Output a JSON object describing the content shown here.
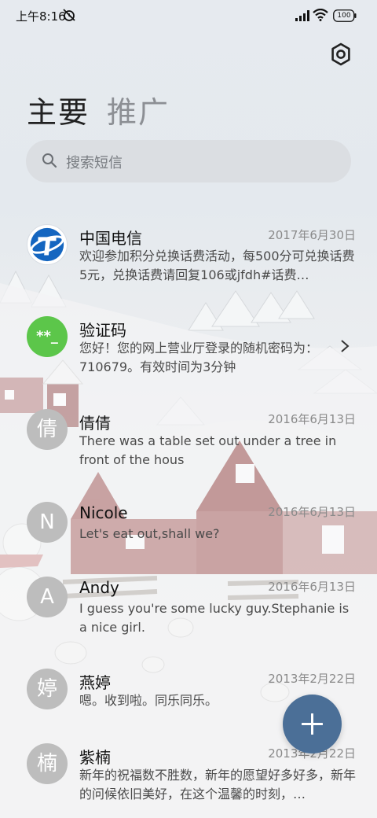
{
  "status_bar": {
    "time": "上午8:16",
    "battery": "100"
  },
  "tabs": [
    {
      "label": "主要"
    },
    {
      "label": "推广"
    }
  ],
  "search": {
    "placeholder": "搜索短信"
  },
  "messages": [
    {
      "sender": "中国电信",
      "date": "2017年6月30日",
      "preview": "欢迎参加积分兑换话费活动，每500分可兑换话费5元，兑换话费请回复106或jfdh#话费…",
      "avatar": "china-telecom-logo"
    },
    {
      "sender": "验证码",
      "date": "",
      "preview": "您好！您的网上营业厅登录的随机密码为：710679。有效时间为3分钟",
      "avatar_text": "**_"
    },
    {
      "sender": "倩倩",
      "date": "2016年6月13日",
      "preview": "There was a table set out under a tree in front of the hous",
      "avatar_text": "倩"
    },
    {
      "sender": "Nicole",
      "date": "2016年6月13日",
      "preview": "Let's eat out,shall we?",
      "avatar_text": "N"
    },
    {
      "sender": "Andy",
      "date": "2016年6月13日",
      "preview": "I guess you're some lucky guy.Stephanie is a nice girl.",
      "avatar_text": "A"
    },
    {
      "sender": "燕婷",
      "date": "2013年2月22日",
      "preview": "嗯。收到啦。同乐同乐。",
      "avatar_text": "婷"
    },
    {
      "sender": "紫楠",
      "date": "2013年2月22日",
      "preview": "新年的祝福数不胜数，新年的愿望好多好多，新年的问候依旧美好，在这个温馨的时刻，…",
      "avatar_text": "楠"
    }
  ],
  "colors": {
    "accent": "#4b6f97",
    "verify_avatar": "#5cc64a",
    "telecom_blue": "#1566c0",
    "letter_avatar": "#bdbdbd"
  }
}
